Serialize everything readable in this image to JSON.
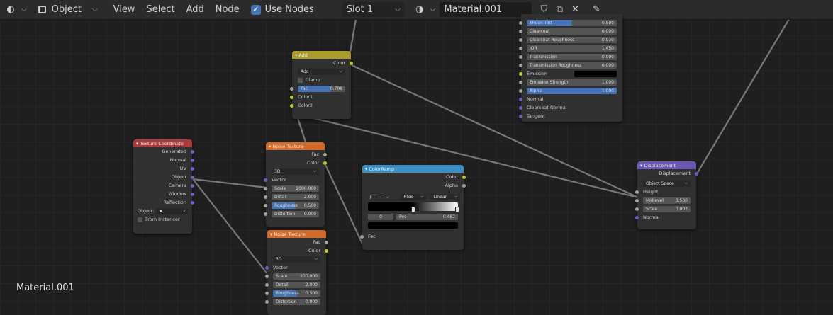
{
  "header": {
    "mode": "Object",
    "menus": [
      "View",
      "Select",
      "Add",
      "Node"
    ],
    "use_nodes_label": "Use Nodes",
    "slot": "Slot 1",
    "material_name": "Material.001"
  },
  "overlay_label": "Material.001",
  "nodes": {
    "add": {
      "title": "Add",
      "out_color": "Color",
      "blend": "Add",
      "clamp": "Clamp",
      "fac_label": "Fac",
      "fac_value": "0.708",
      "in1": "Color1",
      "in2": "Color2"
    },
    "texcoord": {
      "title": "Texture Coordinate",
      "outputs": [
        "Generated",
        "Normal",
        "UV",
        "Object",
        "Camera",
        "Window",
        "Reflection"
      ],
      "object_label": "Object:",
      "from_instancer": "From Instancer"
    },
    "noise1": {
      "title": "Noise Texture",
      "out_fac": "Fac",
      "out_color": "Color",
      "dim": "3D",
      "vector": "Vector",
      "scale_label": "Scale",
      "scale": "2000.000",
      "detail_label": "Detail",
      "detail": "2.000",
      "rough_label": "Roughness",
      "rough": "0.500",
      "dist_label": "Distortion",
      "dist": "0.000"
    },
    "noise2": {
      "title": "Noise Texture",
      "out_fac": "Fac",
      "out_color": "Color",
      "dim": "3D",
      "vector": "Vector",
      "scale_label": "Scale",
      "scale": "200.000",
      "detail_label": "Detail",
      "detail": "2.000",
      "rough_label": "Roughness",
      "rough": "0.500",
      "dist_label": "Distortion",
      "dist": "0.000"
    },
    "colorramp": {
      "title": "ColorRamp",
      "out_color": "Color",
      "out_alpha": "Alpha",
      "mode": "RGB",
      "interp": "Linear",
      "index": "0",
      "pos_label": "Pos",
      "pos": "0.482",
      "fac": "Fac"
    },
    "bsdf": {
      "rows": [
        {
          "label": "Sheen Tint",
          "value": "0.500",
          "blue": true
        },
        {
          "label": "Clearcoat",
          "value": "0.000"
        },
        {
          "label": "Clearcoat Roughness",
          "value": "0.030"
        },
        {
          "label": "IOR",
          "value": "1.450"
        },
        {
          "label": "Transmission",
          "value": "0.000"
        },
        {
          "label": "Transmission Roughness",
          "value": "0.000"
        }
      ],
      "emission": "Emission",
      "emission_strength_label": "Emission Strength",
      "emission_strength": "1.000",
      "alpha_label": "Alpha",
      "alpha": "1.000",
      "normal": "Normal",
      "clearcoat_normal": "Clearcoat Normal",
      "tangent": "Tangent"
    },
    "displacement": {
      "title": "Displacement",
      "out": "Displacement",
      "space": "Object Space",
      "height": "Height",
      "midlevel_label": "Midlevel",
      "midlevel": "0.500",
      "scale_label": "Scale",
      "scale": "0.002",
      "normal": "Normal"
    }
  },
  "colors": {
    "header_bg": "#2b2b2b",
    "canvas_bg": "#1f1f1f",
    "accent": "#4772b3",
    "input_header": "#a83c3c",
    "texture_header": "#d06a2a",
    "converter_header": "#3b8fc2",
    "color_header": "#a99c2c",
    "vector_header": "#6a56b3"
  }
}
